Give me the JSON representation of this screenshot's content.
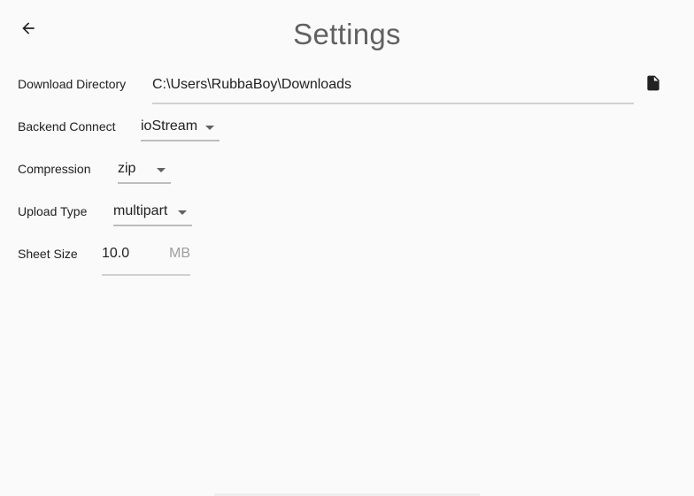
{
  "header": {
    "title": "Settings"
  },
  "fields": {
    "download_directory": {
      "label": "Download Directory",
      "value": "C:\\Users\\RubbaBoy\\Downloads"
    },
    "backend_connect": {
      "label": "Backend Connect",
      "value": "ioStream"
    },
    "compression": {
      "label": "Compression",
      "value": "zip"
    },
    "upload_type": {
      "label": "Upload Type",
      "value": "multipart"
    },
    "sheet_size": {
      "label": "Sheet Size",
      "value": "10.0",
      "unit": "MB"
    }
  },
  "icons": {
    "back": "arrow-left-icon",
    "file": "file-icon"
  },
  "colors": {
    "background": "#fafafa",
    "title": "#616161",
    "underline": "#d0d0d0",
    "unit": "#9e9e9e"
  }
}
